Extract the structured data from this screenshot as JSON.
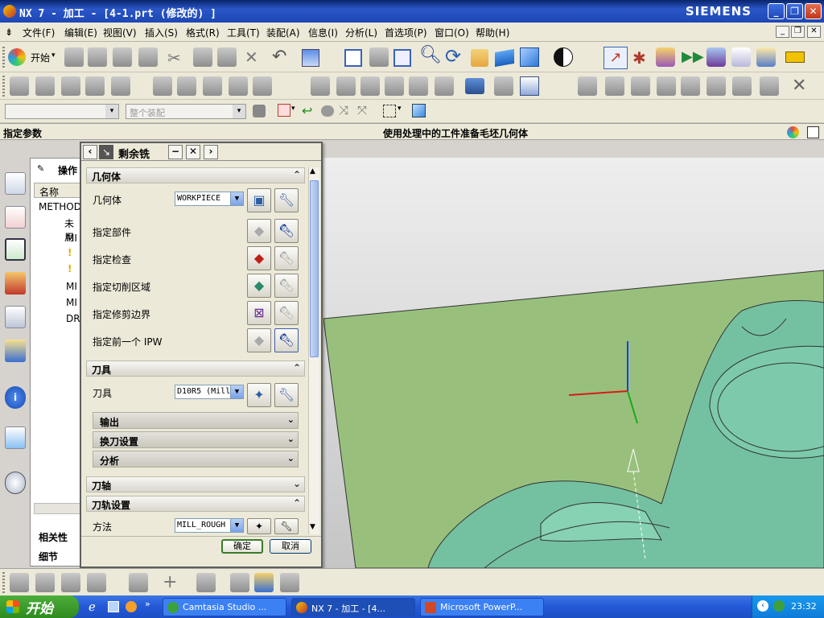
{
  "window": {
    "title": "NX 7 - 加工 - [4-1.prt  (修改的) ]",
    "brand": "SIEMENS"
  },
  "menu": [
    "文件(F)",
    "编辑(E)",
    "视图(V)",
    "插入(S)",
    "格式(R)",
    "工具(T)",
    "装配(A)",
    "信息(I)",
    "分析(L)",
    "首选项(P)",
    "窗口(O)",
    "帮助(H)"
  ],
  "toolbar": {
    "start_label": "开始",
    "assembly_filter": "整个装配"
  },
  "cue": {
    "left": "指定参数",
    "center": "使用处理中的工件准备毛坯几何体"
  },
  "navigator": {
    "title": "操作",
    "column": "名称",
    "items": [
      "METHOD",
      "未用",
      "MI",
      "MI",
      "MI",
      "DR"
    ],
    "footer": [
      "相关性",
      "细节"
    ]
  },
  "dialog": {
    "title": "剩余铣",
    "geometry": {
      "header": "几何体",
      "geometry_label": "几何体",
      "geometry_value": "WORKPIECE",
      "rows": [
        "指定部件",
        "指定检查",
        "指定切削区域",
        "指定修剪边界",
        "指定前一个 IPW"
      ]
    },
    "tool": {
      "header": "刀具",
      "tool_label": "刀具",
      "tool_value": "D10R5 (Mill",
      "subsections": [
        "输出",
        "换刀设置",
        "分析"
      ]
    },
    "axis": {
      "header": "刀轴"
    },
    "path": {
      "header": "刀轨设置",
      "method_label": "方法",
      "method_value": "MILL_ROUGH"
    },
    "ok": "确定",
    "cancel": "取消"
  },
  "taskbar": {
    "start": "开始",
    "tasks": [
      "Camtasia Studio ...",
      "NX 7 - 加工 - [4...",
      "Microsoft PowerP..."
    ],
    "clock": "23:32"
  },
  "colors": {
    "part": "#74c1a2",
    "floor": "#98c07c",
    "titlebar": "#0a246a"
  }
}
